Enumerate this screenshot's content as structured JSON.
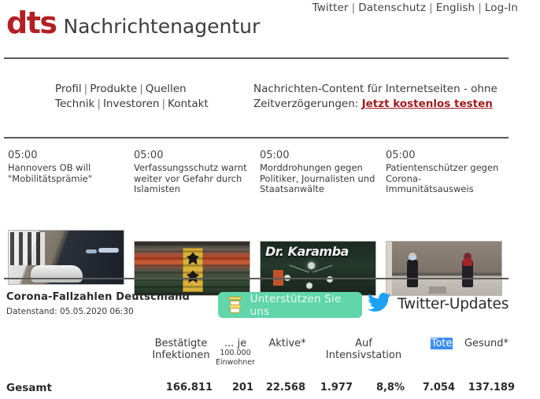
{
  "topnav": {
    "items": [
      {
        "label": "Twitter"
      },
      {
        "label": "Datenschutz"
      },
      {
        "label": "English"
      },
      {
        "label": "Log-In"
      }
    ],
    "separator": "|"
  },
  "masthead": {
    "logo": "dts",
    "wordmark": "Nachrichtenagentur"
  },
  "midsection": {
    "left_links_row1": [
      {
        "label": "Profil"
      },
      {
        "label": "Produkte"
      },
      {
        "label": "Quellen"
      }
    ],
    "left_links_row2": [
      {
        "label": "Technik"
      },
      {
        "label": "Investoren"
      },
      {
        "label": "Kontakt"
      }
    ],
    "separator": "|",
    "promo_line1": "Nachrichten-Content für Internetseiten - ohne",
    "promo_line2_prefix": "Zeitverzögerungen:",
    "promo_cta": "Jetzt kostenlos testen"
  },
  "news": [
    {
      "time": "05:00",
      "title": "Hannovers OB will \"Mobilitätsprämie\"",
      "image_alt": "Elektroauto an Ladesäule"
    },
    {
      "time": "05:00",
      "title": "Verfassungsschutz warnt weiter vor Gefahr durch Islamisten",
      "image_alt": "Gebäude mit Bundesadler-Schild"
    },
    {
      "time": "05:00",
      "title": "Morddrohungen gegen Politiker, Journalisten und Staatsanwälte",
      "image_alt": "Leuchtschrift Dr. Karamba"
    },
    {
      "time": "05:00",
      "title": "Patientenschützer gegen Corona-Immunitätsausweis",
      "image_alt": "Zwei Personen mit Maske in Unterführung"
    }
  ],
  "corona": {
    "title": "Corona-Fallzahlen Deutschland",
    "subtitle": "Datenstand: 05.05.2020 06:30",
    "support_button": "Unterstützen Sie uns",
    "twitter_updates": "Twitter-Updates"
  },
  "table": {
    "headers": {
      "bestaetigte_line1": "Bestätigte",
      "bestaetigte_line2": "Infektionen",
      "je_line1": "... je",
      "je_line2": "100.000",
      "je_line3": "Einwohner",
      "aktive": "Aktive*",
      "intensiv_line1": "Auf",
      "intensiv_line2": "Intensivstation",
      "tote": "Tote",
      "gesund": "Gesund*"
    },
    "rows": [
      {
        "label": "Gesamt",
        "bestaetigte_infektionen": "166.811",
        "je_100000_einwohner": "201",
        "aktive": "22.568",
        "auf_intensivstation": "1.977",
        "intensiv_anteil": "8,8%",
        "tote": "7.054",
        "gesund": "137.189"
      }
    ]
  },
  "colors": {
    "brand_red": "#B22025",
    "cta_red": "#A01B20",
    "support_green": "#62D6AB",
    "twitter_blue": "#1DA1F2",
    "highlight_blue": "#3B8EF5",
    "rule_gray": "#595959"
  }
}
